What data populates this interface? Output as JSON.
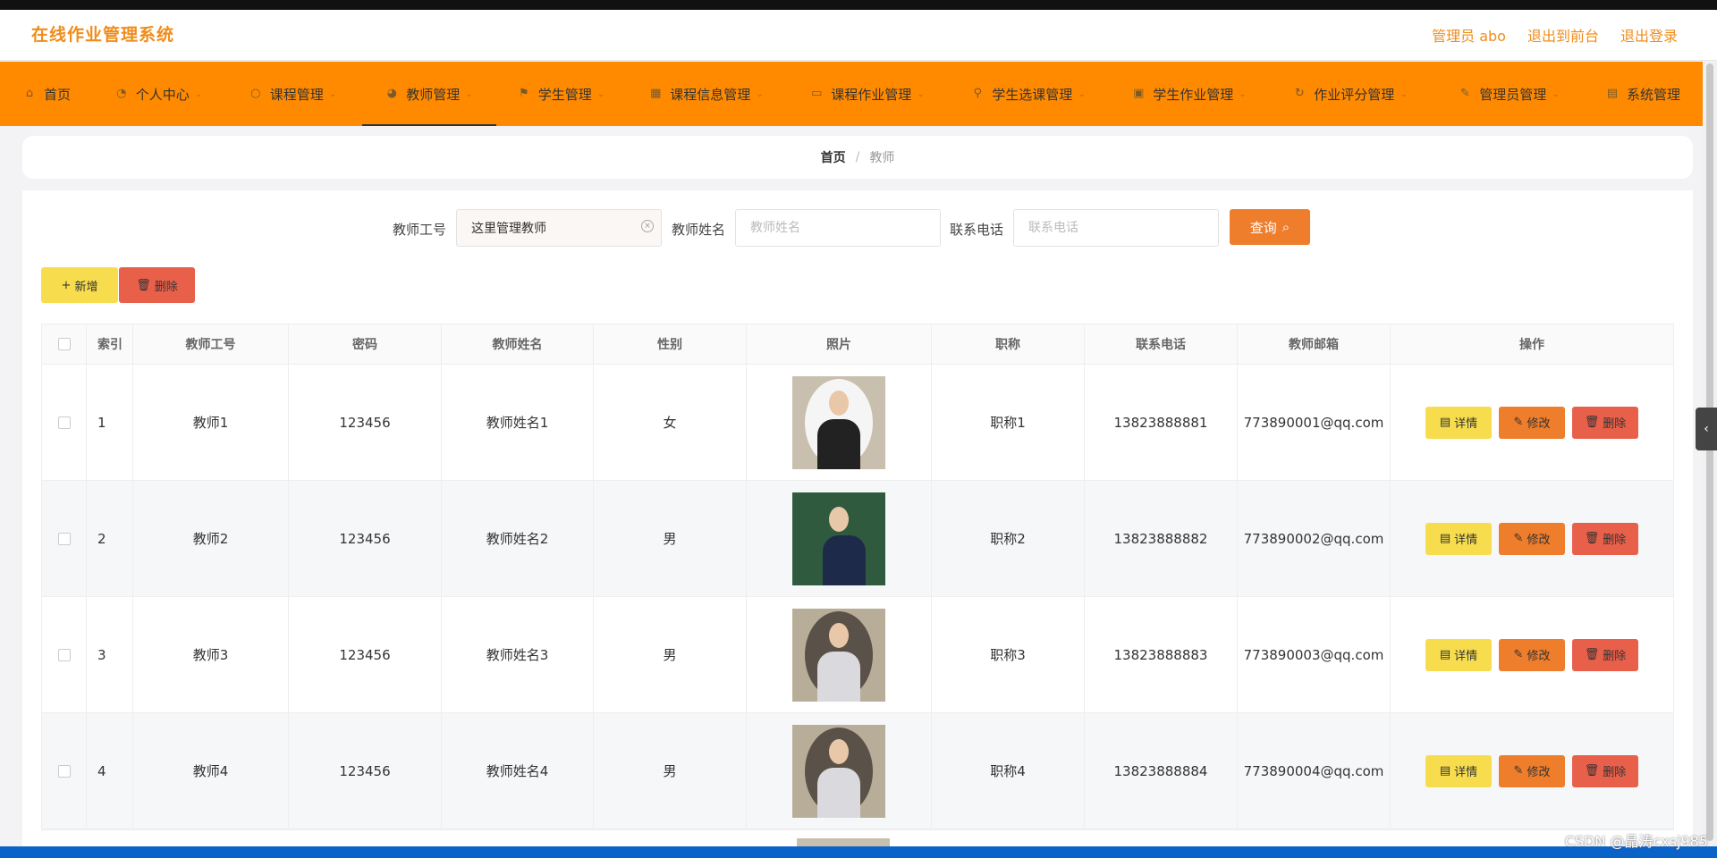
{
  "app_title": "在线作业管理系统",
  "header_links": [
    "管理员 abo",
    "退出到前台",
    "退出登录"
  ],
  "nav": [
    {
      "label": "首页",
      "icon": "home-icon",
      "glyph": "⌂",
      "chevron": false
    },
    {
      "label": "个人中心",
      "icon": "user-icon",
      "glyph": "◔",
      "chevron": true
    },
    {
      "label": "课程管理",
      "icon": "circle-icon",
      "glyph": "○",
      "chevron": true
    },
    {
      "label": "教师管理",
      "icon": "person-icon",
      "glyph": "◕",
      "chevron": true
    },
    {
      "label": "学生管理",
      "icon": "flag-icon",
      "glyph": "⚑",
      "chevron": true
    },
    {
      "label": "课程信息管理",
      "icon": "grid-icon",
      "glyph": "▦",
      "chevron": true
    },
    {
      "label": "课程作业管理",
      "icon": "comment-icon",
      "glyph": "▭",
      "chevron": true
    },
    {
      "label": "学生选课管理",
      "icon": "pin-icon",
      "glyph": "⚲",
      "chevron": true
    },
    {
      "label": "学生作业管理",
      "icon": "bag-icon",
      "glyph": "▣",
      "chevron": true
    },
    {
      "label": "作业评分管理",
      "icon": "refresh-icon",
      "glyph": "↻",
      "chevron": true
    },
    {
      "label": "管理员管理",
      "icon": "pen-icon",
      "glyph": "✎",
      "chevron": true
    },
    {
      "label": "系统管理",
      "icon": "doc-icon",
      "glyph": "▤",
      "chevron": false
    }
  ],
  "active_nav": "教师管理",
  "breadcrumb": {
    "home": "首页",
    "separator": "/",
    "current": "教师"
  },
  "search": {
    "teacher_id_label": "教师工号",
    "teacher_id_value": "这里管理教师",
    "teacher_name_label": "教师姓名",
    "teacher_name_placeholder": "教师姓名",
    "phone_label": "联系电话",
    "phone_placeholder": "联系电话",
    "query_label": "查询"
  },
  "actions": {
    "add_label": "新增",
    "delete_label": "删除"
  },
  "table": {
    "headers": [
      "索引",
      "教师工号",
      "密码",
      "教师姓名",
      "性别",
      "照片",
      "职称",
      "联系电话",
      "教师邮箱",
      "操作"
    ],
    "rows": [
      {
        "index": "1",
        "teacher_id": "教师1",
        "password": "123456",
        "name": "教师姓名1",
        "gender": "女",
        "title": "职称1",
        "phone": "13823888881",
        "email": "773890001@qq.com"
      },
      {
        "index": "2",
        "teacher_id": "教师2",
        "password": "123456",
        "name": "教师姓名2",
        "gender": "男",
        "title": "职称2",
        "phone": "13823888882",
        "email": "773890002@qq.com"
      },
      {
        "index": "3",
        "teacher_id": "教师3",
        "password": "123456",
        "name": "教师姓名3",
        "gender": "男",
        "title": "职称3",
        "phone": "13823888883",
        "email": "773890003@qq.com"
      },
      {
        "index": "4",
        "teacher_id": "教师4",
        "password": "123456",
        "name": "教师姓名4",
        "gender": "男",
        "title": "职称4",
        "phone": "13823888884",
        "email": "773890004@qq.com"
      }
    ],
    "row_actions": {
      "detail": "详情",
      "edit": "修改",
      "remove": "删除"
    }
  },
  "watermark": "CSDN @晶涛cxsj985",
  "colors": {
    "brand": "#f08c1a",
    "navbar": "#ff8a00",
    "query": "#ee7d2c",
    "add": "#f7dd4e",
    "delete": "#e8604a"
  }
}
